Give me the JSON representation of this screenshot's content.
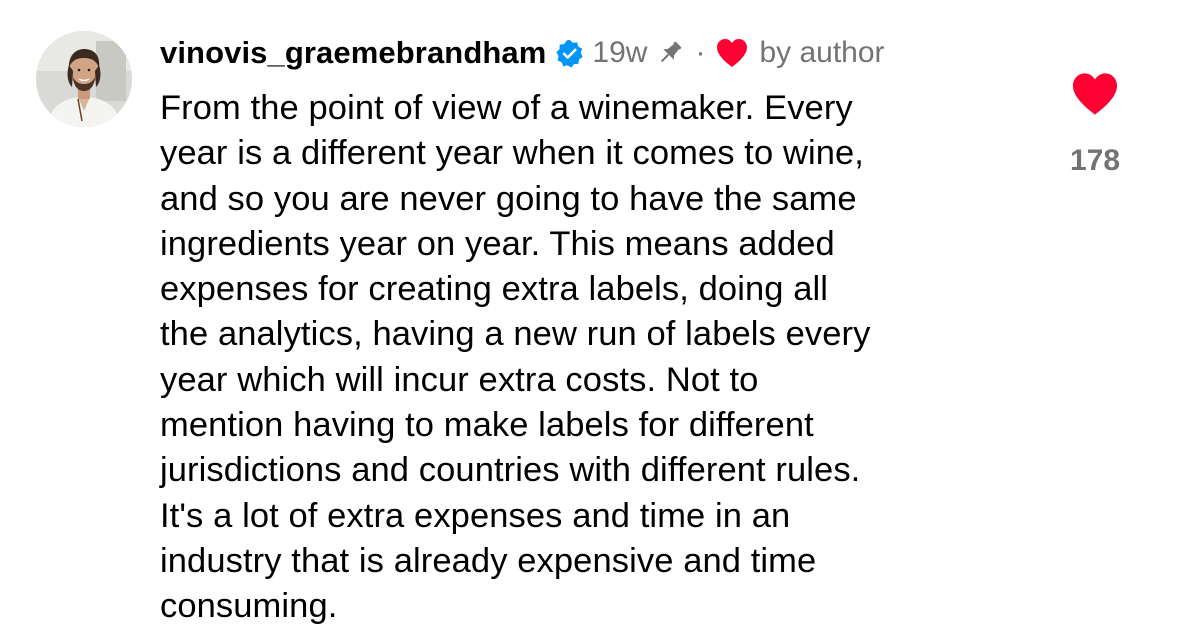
{
  "comment": {
    "username": "vinovis_graemebrandham",
    "verified": true,
    "time_ago": "19w",
    "pinned": true,
    "separator": "·",
    "liked_by_author_label": "by author",
    "text_lines": [
      "From the point of view of a winemaker. Every",
      "year is a different year when it comes to wine,",
      "and so you are never going to have the same",
      "ingredients year on year. This means added",
      "expenses for creating extra labels, doing all",
      "the analytics, having a new run of labels every",
      "year which will incur extra costs. Not to",
      "mention having to make labels for different",
      "jurisdictions and countries with different rules.",
      "It's a lot of extra expenses and time in an",
      "industry that is already expensive and time",
      "consuming."
    ],
    "like_count": "178",
    "liked": true
  },
  "icons": {
    "verified": "verified-badge-icon",
    "pin": "pin-icon",
    "author_heart": "heart-icon",
    "like": "heart-filled-icon"
  },
  "colors": {
    "like_red": "#ff0033",
    "verified_blue": "#0095f6",
    "secondary_text": "#737373",
    "pin_gray": "#737373"
  }
}
